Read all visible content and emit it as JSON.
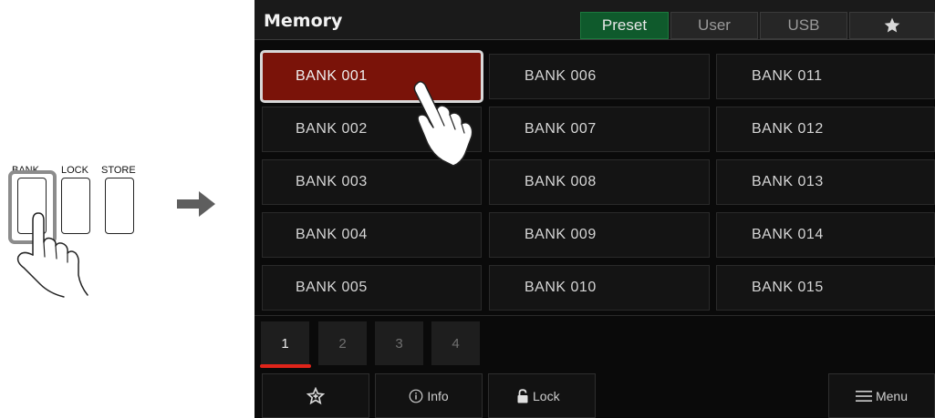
{
  "hardware": {
    "buttons": [
      "BANK",
      "LOCK",
      "STORE"
    ]
  },
  "screen": {
    "title": "Memory",
    "tabs": [
      {
        "label": "Preset",
        "active": true
      },
      {
        "label": "User",
        "active": false
      },
      {
        "label": "USB",
        "active": false
      },
      {
        "label": "favorite-star-icon",
        "active": false
      }
    ],
    "banks": [
      "BANK 001",
      "BANK 002",
      "BANK 003",
      "BANK 004",
      "BANK 005",
      "BANK 006",
      "BANK 007",
      "BANK 008",
      "BANK 009",
      "BANK 010",
      "BANK 011",
      "BANK 012",
      "BANK 013",
      "BANK 014",
      "BANK 015"
    ],
    "selected_bank": "BANK 001",
    "pages": [
      "1",
      "2",
      "3",
      "4"
    ],
    "current_page": "1",
    "bottom": {
      "favorite_icon": "favorite-star-plus-icon",
      "info_label": "Info",
      "lock_label": "Lock",
      "menu_label": "Menu"
    }
  },
  "colors": {
    "selected_bank": "#7a1309",
    "active_tab": "#0f5a2c",
    "page_indicator": "#e0241a"
  }
}
